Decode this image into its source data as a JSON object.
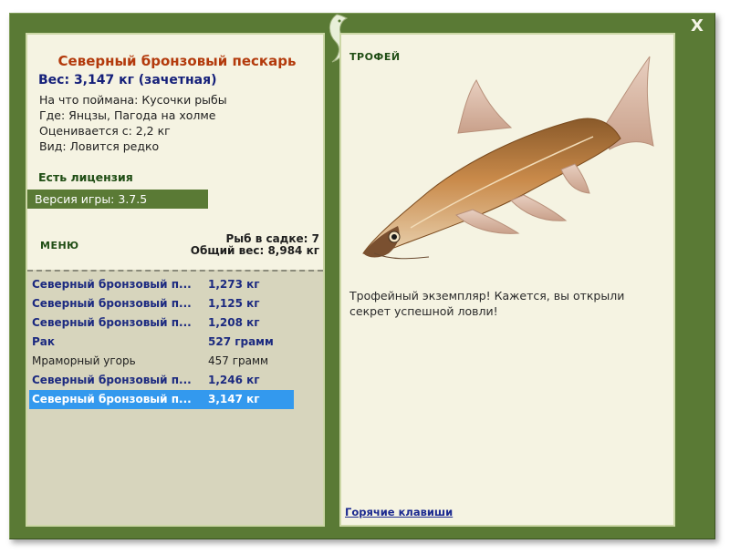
{
  "window": {
    "close_label": "X"
  },
  "fish": {
    "name": "Северный бронзовый пескарь",
    "weight_line": "Вес: 3,147 кг (зачетная)",
    "bait_line": "На что поймана: Кусочки рыбы",
    "location_line": "Где: Янцзы, Пагода на холме",
    "price_line": "Оценивается с: 2,2 кг",
    "type_line": "Вид: Ловится редко"
  },
  "license": "Есть лицензия",
  "version": "Версия игры: 3.7.5",
  "menu_label": "МЕНЮ",
  "keepnet": {
    "count_line": "Рыб в садке: 7",
    "total_line": "Общий вес: 8,984 кг"
  },
  "catch_list": [
    {
      "name": "Северный бронзовый п...",
      "weight": "1,273 кг"
    },
    {
      "name": "Северный бронзовый п...",
      "weight": "1,125 кг"
    },
    {
      "name": "Северный бронзовый п...",
      "weight": "1,208 кг"
    },
    {
      "name": "Рак",
      "weight": "527 грамм"
    },
    {
      "name": "Мраморный угорь",
      "weight": "457 грамм"
    },
    {
      "name": "Северный бронзовый п...",
      "weight": "1,246 кг"
    },
    {
      "name": "Северный бронзовый п...",
      "weight": "3,147 кг"
    }
  ],
  "trophy": {
    "label": "ТРОФЕЙ",
    "text": "Трофейный экземпляр! Кажется, вы открыли секрет успешной ловли!"
  },
  "hotkeys_link": "Горячие клавиши",
  "colors": {
    "frame_green": "#5a7a35",
    "panel_bg": "#f5f3e2",
    "list_bg": "#d7d5bd",
    "title_red": "#b33a0c",
    "label_navy": "#15207a",
    "selected_blue": "#3399ee"
  }
}
